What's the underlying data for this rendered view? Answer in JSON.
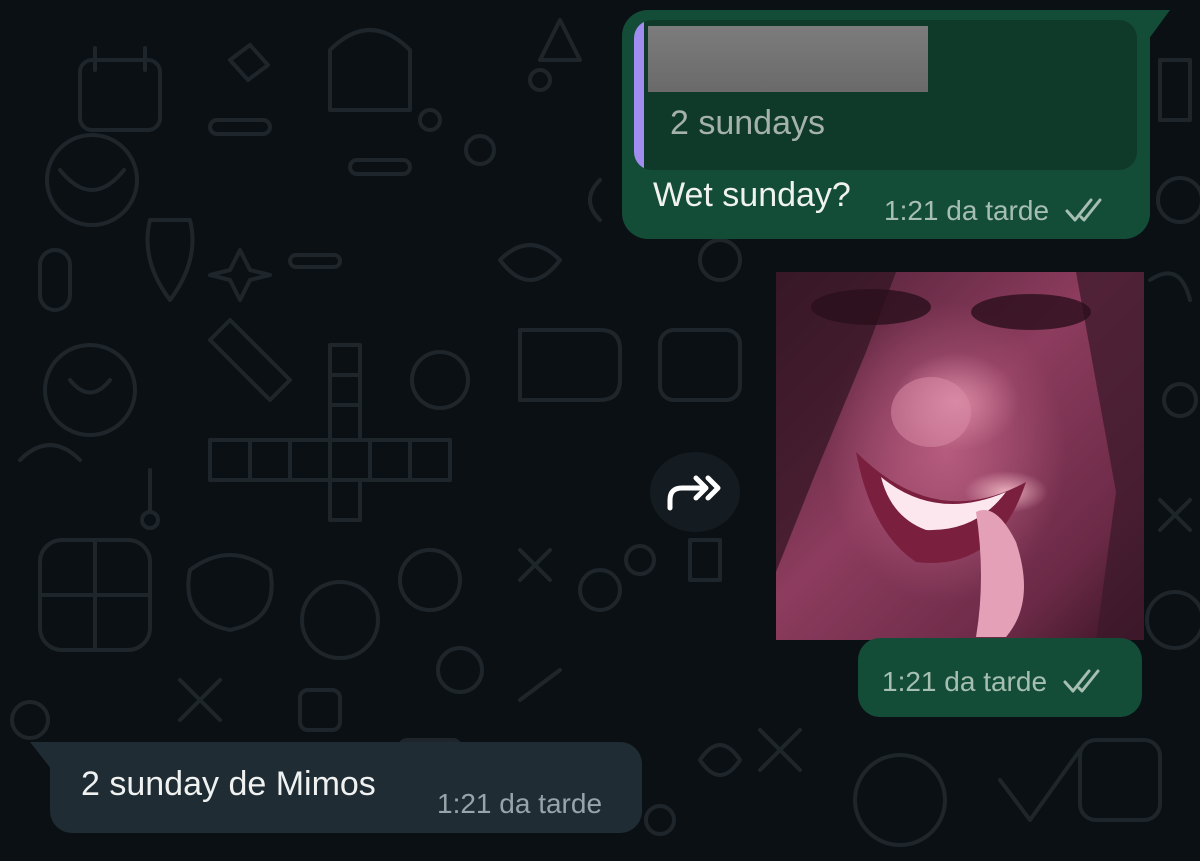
{
  "chat": {
    "messages": [
      {
        "direction": "outgoing",
        "reply": {
          "sender_redacted": true,
          "text": "2 sundays"
        },
        "text": "Wet sunday?",
        "time": "1:21 da tarde",
        "status_icon": "double-check-icon"
      },
      {
        "direction": "outgoing",
        "type": "image",
        "time": "1:21 da tarde",
        "status_icon": "double-check-icon",
        "forward_icon": "forward-icon"
      },
      {
        "direction": "incoming",
        "text": "2 sunday de Mimos",
        "time": "1:21 da tarde"
      }
    ]
  },
  "colors": {
    "background": "#0b1014",
    "outgoing_bubble": "#144d37",
    "incoming_bubble": "#1f2c33",
    "reply_bar": "#a18cf0"
  }
}
